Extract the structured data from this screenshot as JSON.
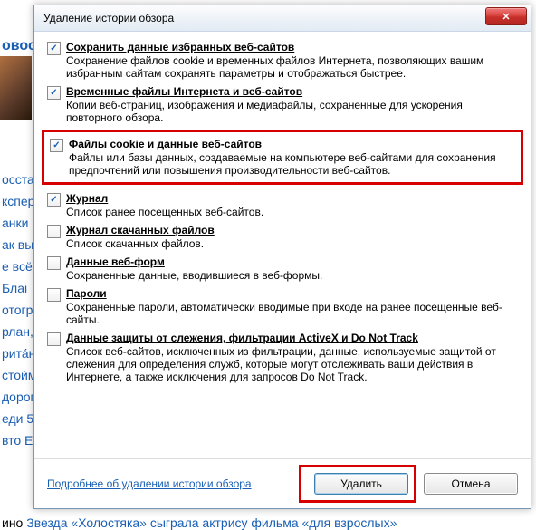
{
  "background": {
    "links": [
      "овос",
      "осстан",
      "кспері",
      "анки",
      "ак вы",
      "е всё",
      "Блаі",
      "отогр",
      "рлан,",
      "рита́н",
      "стои́м",
      "дорог",
      "еди 5",
      "вто Е"
    ],
    "news_prefix": "ино ",
    "news": "Звезда «Холостяка» сыграла актрису фильма «для взрослых»"
  },
  "dialog": {
    "title": "Удаление истории обзора",
    "close_icon": "✕",
    "items": [
      {
        "checked": true,
        "title": "Сохранить данные избранных веб-сайтов",
        "desc": "Сохранение файлов cookie и временных файлов Интернета, позволяющих вашим избранным сайтам сохранять параметры и отображаться быстрее."
      },
      {
        "checked": true,
        "title": "Временные файлы Интернета и веб-сайтов",
        "desc": "Копии веб-страниц, изображения и медиафайлы, сохраненные для ускорения повторного обзора."
      },
      {
        "checked": true,
        "title": "Файлы cookie и данные веб-сайтов",
        "desc": "Файлы или базы данных, создаваемые на компьютере веб-сайтами для сохранения предпочтений или повышения производительности веб-сайтов.",
        "highlight": true
      },
      {
        "checked": true,
        "title": "Журнал",
        "desc": "Список ранее посещенных веб-сайтов."
      },
      {
        "checked": false,
        "title": "Журнал скачанных файлов",
        "desc": "Список скачанных файлов."
      },
      {
        "checked": false,
        "title": "Данные веб-форм",
        "desc": "Сохраненные данные, вводившиеся в веб-формы."
      },
      {
        "checked": false,
        "title": "Пароли",
        "desc": "Сохраненные пароли, автоматически вводимые при входе на ранее посещенные веб-сайты."
      },
      {
        "checked": false,
        "title": "Данные защиты от слежения, фильтрации ActiveX и Do Not Track",
        "desc": "Список веб-сайтов, исключенных из фильтрации, данные, используемые защитой от слежения для определения служб, которые могут отслеживать ваши действия в Интернете, а также исключения для запросов Do Not Track."
      }
    ],
    "learn_more": "Подробнее об удалении истории обзора",
    "delete_btn": "Удалить",
    "cancel_btn": "Отмена"
  }
}
